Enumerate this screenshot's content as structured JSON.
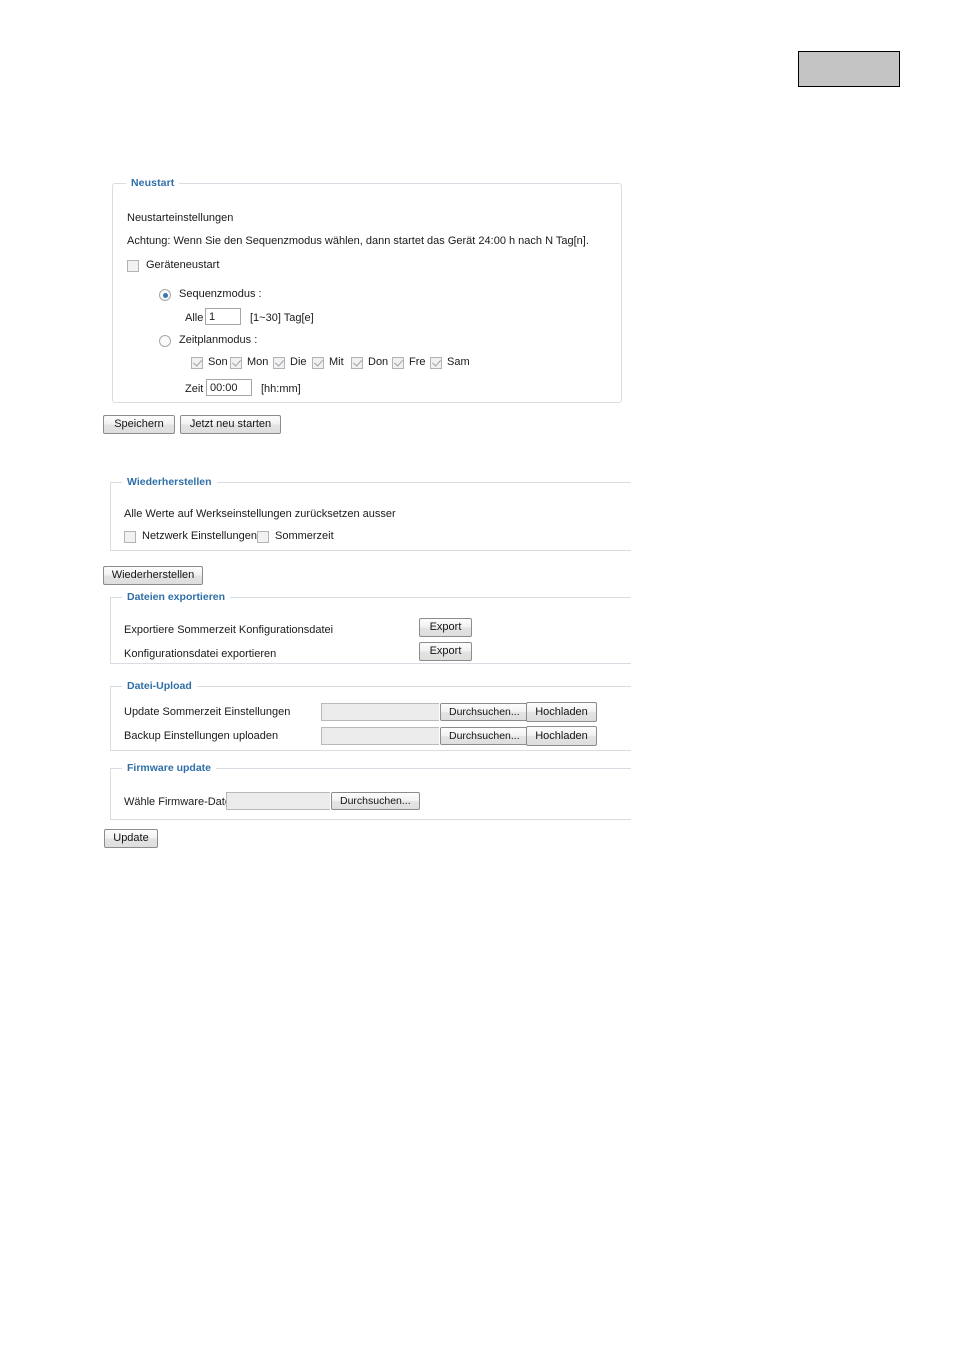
{
  "page": {
    "top_placeholder_color": "#c4c4c4",
    "legend_color": "#2f6fa8"
  },
  "reboot_section": {
    "legend": "Neustart",
    "heading": "Neustarteinstellungen",
    "note": "Achtung: Wenn Sie den Sequenzmodus wählen, dann startet das Gerät 24:00 h nach N Tag[n].",
    "device_reboot_label": "Geräteneustart",
    "device_reboot_checked": false,
    "mode_sequence": {
      "label": "Sequenzmodus :",
      "selected": true,
      "interval_label": "Alle",
      "interval_value": "1",
      "interval_hint": "[1~30] Tag[e]"
    },
    "mode_schedule": {
      "label": "Zeitplanmodus :",
      "selected": false,
      "days": [
        {
          "label": "Son",
          "checked": true
        },
        {
          "label": "Mon",
          "checked": true
        },
        {
          "label": "Die",
          "checked": true
        },
        {
          "label": "Mit",
          "checked": true
        },
        {
          "label": "Don",
          "checked": true
        },
        {
          "label": "Fre",
          "checked": true
        },
        {
          "label": "Sam",
          "checked": true
        }
      ],
      "time_label": "Zeit",
      "time_value": "00:00",
      "time_hint": "[hh:mm]"
    },
    "save_button": "Speichern",
    "reboot_now_button": "Jetzt neu starten"
  },
  "restore_section": {
    "legend": "Wiederherstellen",
    "description": "Alle Werte auf Werkseinstellungen zurücksetzen ausser",
    "options": [
      {
        "label": "Netzwerk Einstellungen",
        "checked": false
      },
      {
        "label": "Sommerzeit",
        "checked": false
      }
    ],
    "restore_button": "Wiederherstellen"
  },
  "export_section": {
    "legend": "Dateien exportieren",
    "rows": [
      {
        "label": "Exportiere Sommerzeit Konfigurationsdatei",
        "button": "Export"
      },
      {
        "label": "Konfigurationsdatei exportieren",
        "button": "Export"
      }
    ]
  },
  "upload_section": {
    "legend": "Datei-Upload",
    "rows": [
      {
        "label": "Update Sommerzeit Einstellungen",
        "field_value": "",
        "browse_button": "Durchsuchen...",
        "upload_button": "Hochladen"
      },
      {
        "label": "Backup Einstellungen uploaden",
        "field_value": "",
        "browse_button": "Durchsuchen...",
        "upload_button": "Hochladen"
      }
    ]
  },
  "firmware_section": {
    "legend": "Firmware update",
    "file_label": "Wähle Firmware-Datei",
    "field_value": "",
    "browse_button": "Durchsuchen...",
    "update_button": "Update"
  }
}
